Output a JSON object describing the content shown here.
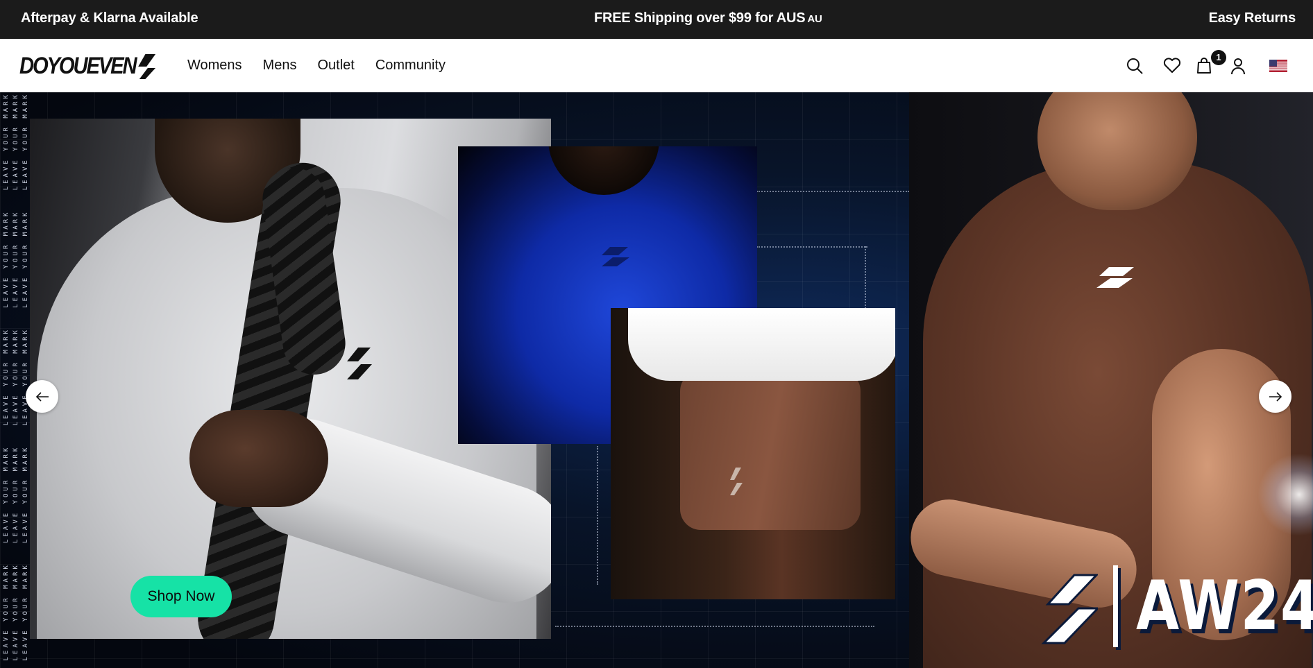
{
  "announcement": {
    "left": "Afterpay & Klarna Available",
    "center": "FREE Shipping over $99 for AUS",
    "center_flag_code": "AU",
    "right": "Easy Returns"
  },
  "header": {
    "logo_text": "DOYOUEVEN",
    "nav": [
      "Womens",
      "Mens",
      "Outlet",
      "Community"
    ],
    "icons": [
      "search-icon",
      "heart-icon",
      "bag-icon",
      "user-icon",
      "us-flag-icon"
    ],
    "cart_count": "1"
  },
  "hero": {
    "side_text": "LEAVE YOUR MARK",
    "cta_label": "Shop Now",
    "collection_label": "AW24",
    "colors": {
      "cta": "#16e2a6",
      "background": "#081429"
    }
  }
}
